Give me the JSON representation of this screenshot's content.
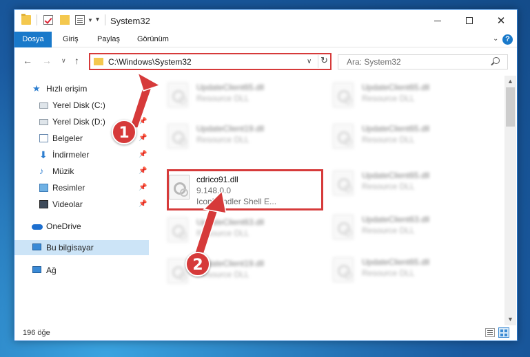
{
  "window": {
    "title": "System32"
  },
  "ribbon": {
    "tabs": [
      "Dosya",
      "Giriş",
      "Paylaş",
      "Görünüm"
    ]
  },
  "address": {
    "path": "C:\\Windows\\System32"
  },
  "search": {
    "placeholder": "Ara: System32"
  },
  "navpane": {
    "items": [
      {
        "label": "Hızlı erişim",
        "icon": "star-icon",
        "pinned": false
      },
      {
        "label": "Yerel Disk (C:)",
        "icon": "drive-icon",
        "pinned": true
      },
      {
        "label": "Yerel Disk (D:)",
        "icon": "drive-icon",
        "pinned": true
      },
      {
        "label": "Belgeler",
        "icon": "documents-icon",
        "pinned": true
      },
      {
        "label": "İndirmeler",
        "icon": "download-icon",
        "pinned": true
      },
      {
        "label": "Müzik",
        "icon": "music-icon",
        "pinned": true
      },
      {
        "label": "Resimler",
        "icon": "pictures-icon",
        "pinned": true
      },
      {
        "label": "Videolar",
        "icon": "videos-icon",
        "pinned": true
      },
      {
        "label": "OneDrive",
        "icon": "cloud-icon",
        "pinned": false
      },
      {
        "label": "Bu bilgisayar",
        "icon": "computer-icon",
        "pinned": false,
        "selected": true
      },
      {
        "label": "Ağ",
        "icon": "network-icon",
        "pinned": false
      }
    ]
  },
  "files": {
    "highlighted": {
      "name": "cdrico91.dll",
      "line2": "9.148.0.0",
      "line3": "IconHandler Shell E..."
    },
    "blurred": [
      {
        "name": "UpdateClient65.dll",
        "line2": "Resource DLL"
      },
      {
        "name": "UpdateClient65.dll",
        "line2": "Resource DLL"
      },
      {
        "name": "UpdateClient19.dll",
        "line2": "Resource DLL"
      },
      {
        "name": "UpdateClient65.dll",
        "line2": "Resource DLL"
      },
      {
        "name": "UpdateClient65.dll",
        "line2": "Resource DLL"
      },
      {
        "name": "UpdateClient63.dll",
        "line2": "Resource DLL"
      },
      {
        "name": "UpdateClient63.dll",
        "line2": "Resource DLL"
      },
      {
        "name": "UpdateClient19.dll",
        "line2": "Resource DLL"
      },
      {
        "name": "UpdateClient65.dll",
        "line2": "Resource DLL"
      }
    ]
  },
  "status": {
    "item_count": "196 öğe"
  },
  "markers": [
    "1",
    "2"
  ],
  "colors": {
    "accent": "#1979ca",
    "highlight_red": "#d63a3a",
    "selected_bg": "#cce4f7"
  }
}
